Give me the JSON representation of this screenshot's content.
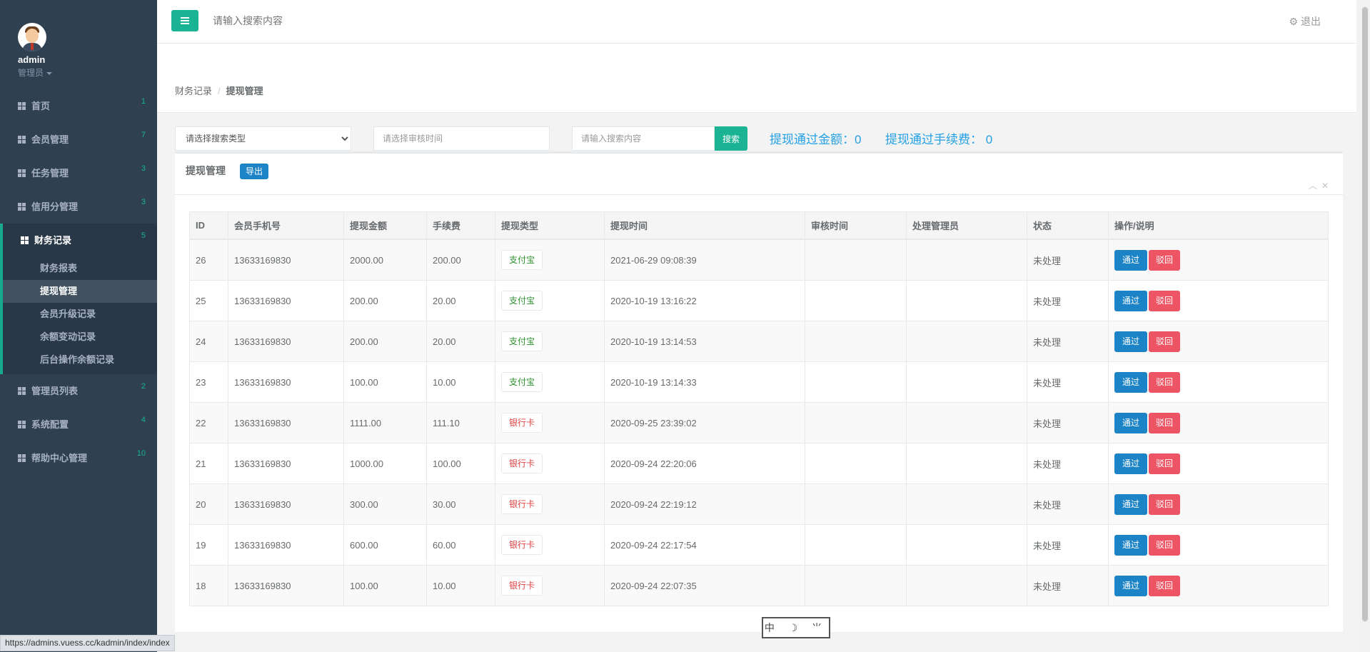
{
  "sidebar": {
    "username": "admin",
    "role": "管理员",
    "menu": [
      {
        "label": "首页",
        "badge": "1"
      },
      {
        "label": "会员管理",
        "badge": "7"
      },
      {
        "label": "任务管理",
        "badge": "3"
      },
      {
        "label": "信用分管理",
        "badge": "3"
      },
      {
        "label": "财务记录",
        "badge": "5"
      },
      {
        "label": "管理员列表",
        "badge": "2"
      },
      {
        "label": "系统配置",
        "badge": "4"
      },
      {
        "label": "帮助中心管理",
        "badge": "10"
      }
    ],
    "finance_sub": [
      "财务报表",
      "提现管理",
      "会员升级记录",
      "余额变动记录",
      "后台操作余额记录"
    ]
  },
  "topbar": {
    "search_placeholder": "请输入搜索内容",
    "logout": "退出"
  },
  "breadcrumb": {
    "parent": "财务记录",
    "sep": "/",
    "current": "提现管理"
  },
  "filters": {
    "type_select": "请选择搜索类型",
    "time_placeholder": "请选择审核时间",
    "content_placeholder": "请输入搜索内容",
    "search_button": "搜索",
    "stat_amount": "提现通过金额：0",
    "stat_fee": "提现通过手续费： 0"
  },
  "panel": {
    "title": "提现管理",
    "export": "导出",
    "columns": [
      "ID",
      "会员手机号",
      "提现金额",
      "手续费",
      "提现类型",
      "提现时间",
      "审核时间",
      "处理管理员",
      "状态",
      "操作/说明"
    ],
    "pass_label": "通过",
    "reject_label": "驳回",
    "rows": [
      {
        "id": "26",
        "phone": "13633169830",
        "amount": "2000.00",
        "fee": "200.00",
        "type": "支付宝",
        "type_kind": "alipay",
        "time": "2021-06-29 09:08:39",
        "audit": "",
        "admin": "",
        "status": "未处理"
      },
      {
        "id": "25",
        "phone": "13633169830",
        "amount": "200.00",
        "fee": "20.00",
        "type": "支付宝",
        "type_kind": "alipay",
        "time": "2020-10-19 13:16:22",
        "audit": "",
        "admin": "",
        "status": "未处理"
      },
      {
        "id": "24",
        "phone": "13633169830",
        "amount": "200.00",
        "fee": "20.00",
        "type": "支付宝",
        "type_kind": "alipay",
        "time": "2020-10-19 13:14:53",
        "audit": "",
        "admin": "",
        "status": "未处理"
      },
      {
        "id": "23",
        "phone": "13633169830",
        "amount": "100.00",
        "fee": "10.00",
        "type": "支付宝",
        "type_kind": "alipay",
        "time": "2020-10-19 13:14:33",
        "audit": "",
        "admin": "",
        "status": "未处理"
      },
      {
        "id": "22",
        "phone": "13633169830",
        "amount": "1111.00",
        "fee": "111.10",
        "type": "银行卡",
        "type_kind": "bank",
        "time": "2020-09-25 23:39:02",
        "audit": "",
        "admin": "",
        "status": "未处理"
      },
      {
        "id": "21",
        "phone": "13633169830",
        "amount": "1000.00",
        "fee": "100.00",
        "type": "银行卡",
        "type_kind": "bank",
        "time": "2020-09-24 22:20:06",
        "audit": "",
        "admin": "",
        "status": "未处理"
      },
      {
        "id": "20",
        "phone": "13633169830",
        "amount": "300.00",
        "fee": "30.00",
        "type": "银行卡",
        "type_kind": "bank",
        "time": "2020-09-24 22:19:12",
        "audit": "",
        "admin": "",
        "status": "未处理"
      },
      {
        "id": "19",
        "phone": "13633169830",
        "amount": "600.00",
        "fee": "60.00",
        "type": "银行卡",
        "type_kind": "bank",
        "time": "2020-09-24 22:17:54",
        "audit": "",
        "admin": "",
        "status": "未处理"
      },
      {
        "id": "18",
        "phone": "13633169830",
        "amount": "100.00",
        "fee": "10.00",
        "type": "银行卡",
        "type_kind": "bank",
        "time": "2020-09-24 22:07:35",
        "audit": "",
        "admin": "",
        "status": "未处理"
      }
    ]
  },
  "statusbar_url": "https://admins.vuess.cc/kadmin/index/index",
  "ime": {
    "label": "中 ☽ ⺌"
  },
  "colors": {
    "sidebar": "#2f4050",
    "accent": "#1ab394",
    "primary": "#1c84c6",
    "danger": "#ed5565",
    "stat": "#23a1e3"
  },
  "icons": {
    "menu": "grid-icon",
    "topbar": "hamburger-icon",
    "logout": "gear-icon",
    "collapse": "chevron-up-icon",
    "close": "close-icon"
  }
}
